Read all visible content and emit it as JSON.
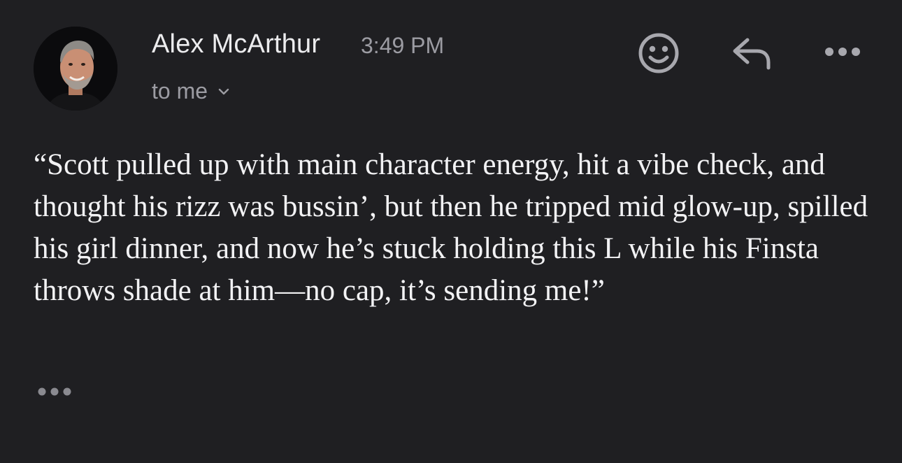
{
  "email": {
    "sender_name": "Alex McArthur",
    "time": "3:49 PM",
    "recipient_label": "to me",
    "body": "“Scott pulled up with main character energy, hit a vibe check, and thought his rizz was bussin’, but then he tripped mid glow-up, spilled his girl dinner, and now he’s stuck holding this L while his Finsta throws shade at him—no cap, it’s sending me!”"
  },
  "actions": {
    "emoji_icon": "smiley-face-icon",
    "reply_icon": "reply-arrow-icon",
    "more_icon": "more-horizontal-icon",
    "expand_icon": "ellipsis-icon"
  },
  "colors": {
    "background": "#1f1f22",
    "primary_text": "#f2f2f4",
    "secondary_text": "#9c9ca3",
    "icon": "#a8a8ae"
  }
}
